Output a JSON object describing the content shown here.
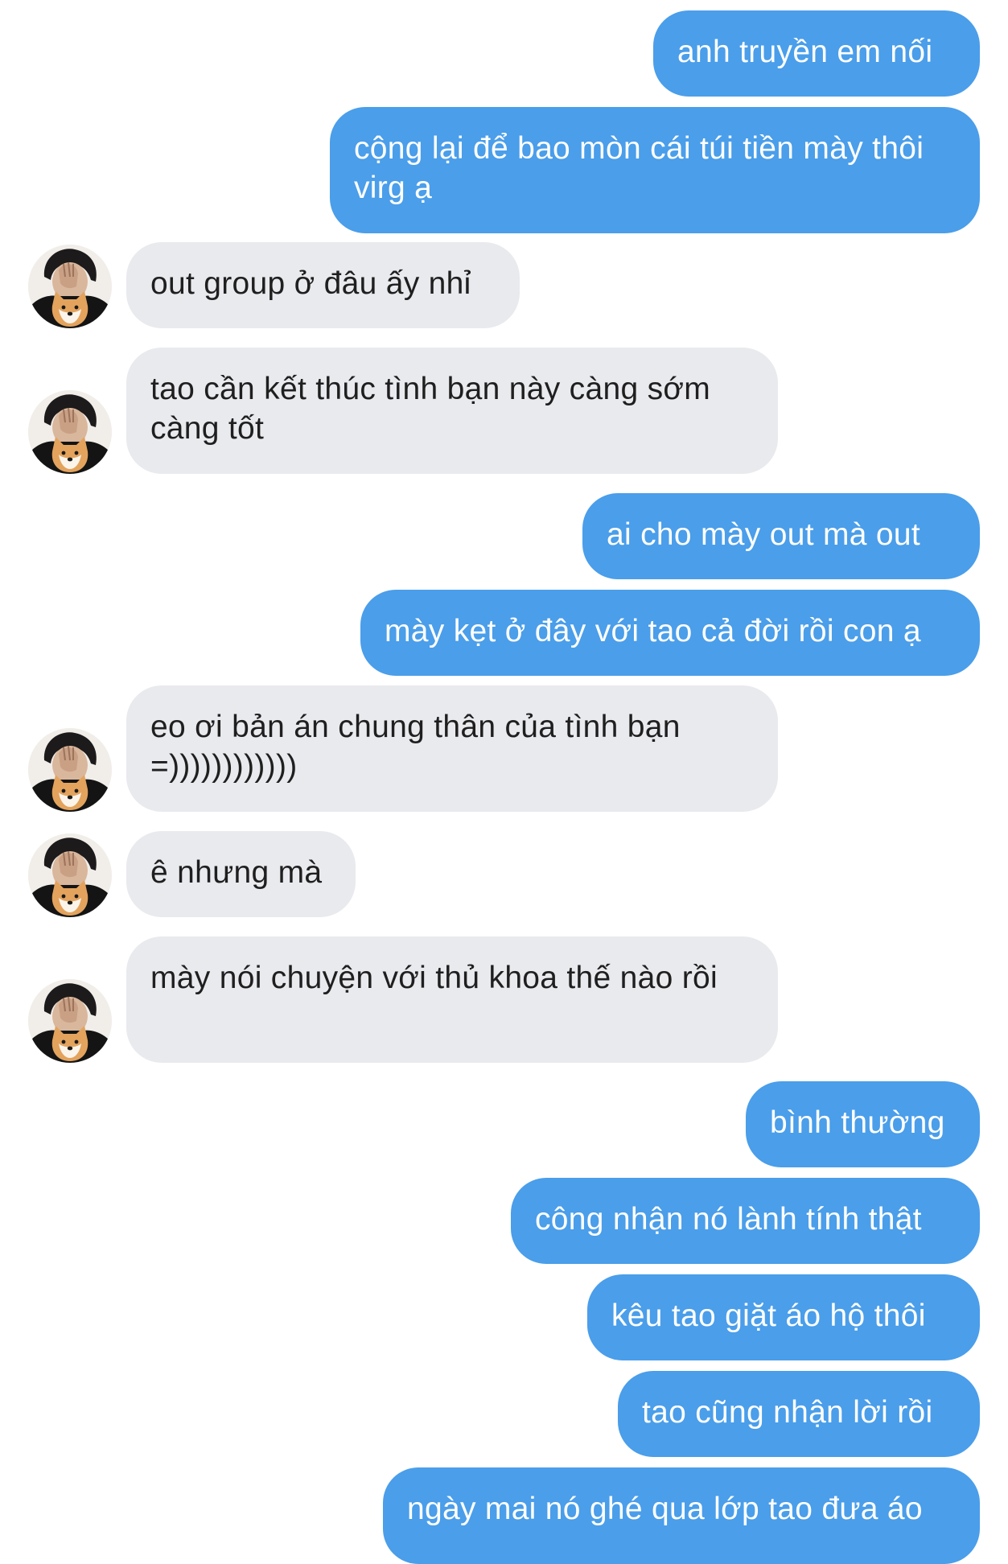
{
  "conversation": {
    "messages": [
      {
        "from": "me",
        "text": "anh truyền em nối"
      },
      {
        "from": "me",
        "text": "cộng lại để bao mòn cái túi tiền mày thôi virg ạ"
      },
      {
        "from": "friend",
        "text": "out group ở đâu ấy nhỉ"
      },
      {
        "from": "friend",
        "text": "tao cần kết thúc tình bạn này càng sớm càng tốt"
      },
      {
        "from": "me",
        "text": "ai cho mày out mà out"
      },
      {
        "from": "me",
        "text": "mày kẹt ở đây với tao cả đời rồi con ạ"
      },
      {
        "from": "friend",
        "text": "eo ơi bản án chung thân của tình bạn =))))))))))))"
      },
      {
        "from": "friend",
        "text": "ê nhưng mà"
      },
      {
        "from": "friend",
        "text": "mày nói chuyện với thủ khoa thế nào rồi"
      },
      {
        "from": "me",
        "text": "bình thường"
      },
      {
        "from": "me",
        "text": "công nhận nó lành tính thật"
      },
      {
        "from": "me",
        "text": "kêu tao giặt áo hộ thôi"
      },
      {
        "from": "me",
        "text": "tao cũng nhận lời rồi"
      },
      {
        "from": "me",
        "text": "ngày mai nó ghé qua lớp tao đưa áo"
      }
    ]
  },
  "colors": {
    "outgoing_bubble": "#4a9eea",
    "incoming_bubble": "#e9eaee",
    "outgoing_text": "#ffffff",
    "incoming_text": "#1f1f1f"
  },
  "avatar": {
    "icon": "friend-avatar-icon"
  }
}
